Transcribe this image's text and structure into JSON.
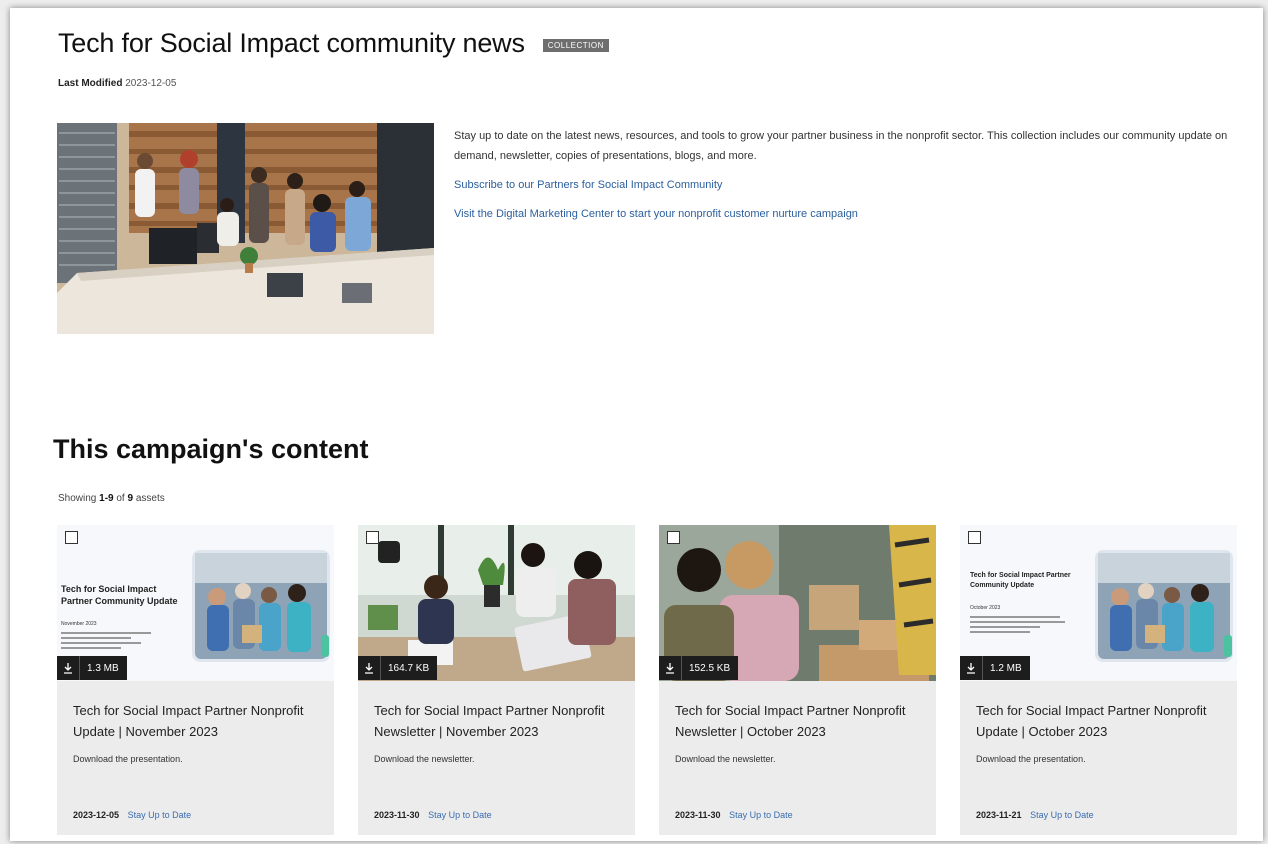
{
  "page": {
    "title": "Tech for Social Impact community news",
    "badge": "COLLECTION",
    "last_modified_label": "Last Modified",
    "last_modified_value": "2023-12-05"
  },
  "intro": {
    "description": "Stay up to date on the latest news, resources, and tools to grow your partner business in the nonprofit sector. This collection includes our community update on demand, newsletter, copies of presentations, blogs, and more.",
    "link_subscribe": "Subscribe to our Partners for Social Impact Community",
    "link_dmc": "Visit the Digital Marketing Center to start your nonprofit customer nurture campaign"
  },
  "campaign": {
    "section_title": "This campaign's content",
    "showing_prefix": "Showing",
    "showing_range": "1-9",
    "showing_of": "of",
    "showing_total": "9",
    "showing_suffix": "assets"
  },
  "cards": [
    {
      "size": "1.3 MB",
      "title": "Tech for Social Impact Partner Nonprofit Update | November 2023",
      "description": "Download the presentation.",
      "date": "2023-12-05",
      "tag": "Stay Up to Date",
      "thumb_heading": "Tech for Social Impact Partner Community Update",
      "thumb_sub": "November 2023"
    },
    {
      "size": "164.7 KB",
      "title": "Tech for Social Impact Partner Nonprofit Newsletter | November 2023",
      "description": "Download the newsletter.",
      "date": "2023-11-30",
      "tag": "Stay Up to Date"
    },
    {
      "size": "152.5 KB",
      "title": "Tech for Social Impact Partner Nonprofit Newsletter | October 2023",
      "description": "Download the newsletter.",
      "date": "2023-11-30",
      "tag": "Stay Up to Date"
    },
    {
      "size": "1.2 MB",
      "title": "Tech for Social Impact Partner Nonprofit Update | October 2023",
      "description": "Download the presentation.",
      "date": "2023-11-21",
      "tag": "Stay Up to Date",
      "thumb_heading": "Tech for Social Impact Partner Community Update",
      "thumb_sub": "October 2023"
    }
  ],
  "colors": {
    "link": "#2b5f9e",
    "card_bg": "#ececec",
    "badge_bg": "#6e6e6e"
  }
}
